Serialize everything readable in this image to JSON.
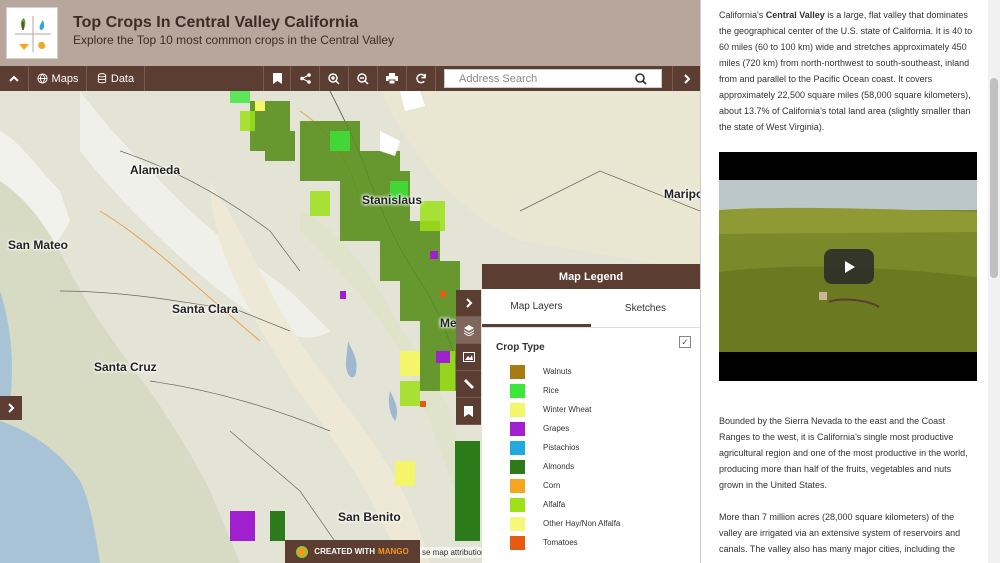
{
  "header": {
    "title": "Top Crops In Central Valley California",
    "subtitle": "Explore the Top 10 most common crops in the Central Valley"
  },
  "toolbar": {
    "maps_label": "Maps",
    "data_label": "Data",
    "search_placeholder": "Address Search"
  },
  "map": {
    "places": [
      "Alameda",
      "Stanislaus",
      "San Mateo",
      "Santa Clara",
      "Santa Cruz",
      "San Benito",
      "Maripo",
      "Me"
    ],
    "attribution": "se map attribution",
    "badge": {
      "prefix": "CREATED WITH",
      "brand": "MANGO"
    }
  },
  "legend": {
    "title": "Map Legend",
    "tabs": [
      "Map Layers",
      "Sketches"
    ],
    "group": "Crop Type",
    "crops": [
      {
        "name": "Walnuts",
        "color": "#a87a14"
      },
      {
        "name": "Rice",
        "color": "#39e639"
      },
      {
        "name": "Winter Wheat",
        "color": "#f5f56a"
      },
      {
        "name": "Grapes",
        "color": "#a020d0"
      },
      {
        "name": "Pistachios",
        "color": "#22a9e0"
      },
      {
        "name": "Almonds",
        "color": "#2d7a1a"
      },
      {
        "name": "Corn",
        "color": "#f5a623"
      },
      {
        "name": "Alfalfa",
        "color": "#9ee01a"
      },
      {
        "name": "Other Hay/Non Alfalfa",
        "color": "#f7f77a"
      },
      {
        "name": "Tomatoes",
        "color": "#e85a10"
      }
    ]
  },
  "panel": {
    "intro_pre": "California's ",
    "intro_bold": "Central Valley",
    "intro_post": " is a large, flat valley that dominates the geographical center of the U.S. state of California. It is 40 to 60 miles (60 to 100 km) wide and stretches approximately 450 miles (720 km) from north-northwest to south-southeast, inland from and parallel to the Pacific Ocean coast. It covers approximately 22,500 square miles (58,000 square kilometers), about 13.7% of California's total land area (slightly smaller than the state of West Virginia).",
    "para2": "Bounded by the Sierra Nevada to the east and the Coast Ranges to the west, it is California's single most productive agricultural region and one of the most productive in the world, producing more than half of the fruits, vegetables and nuts grown in the United States.",
    "para3": "More than 7 million acres (28,000 square kilometers) of the valley are irrigated via an extensive system of reservoirs and canals. The valley also has many major cities, including the"
  }
}
